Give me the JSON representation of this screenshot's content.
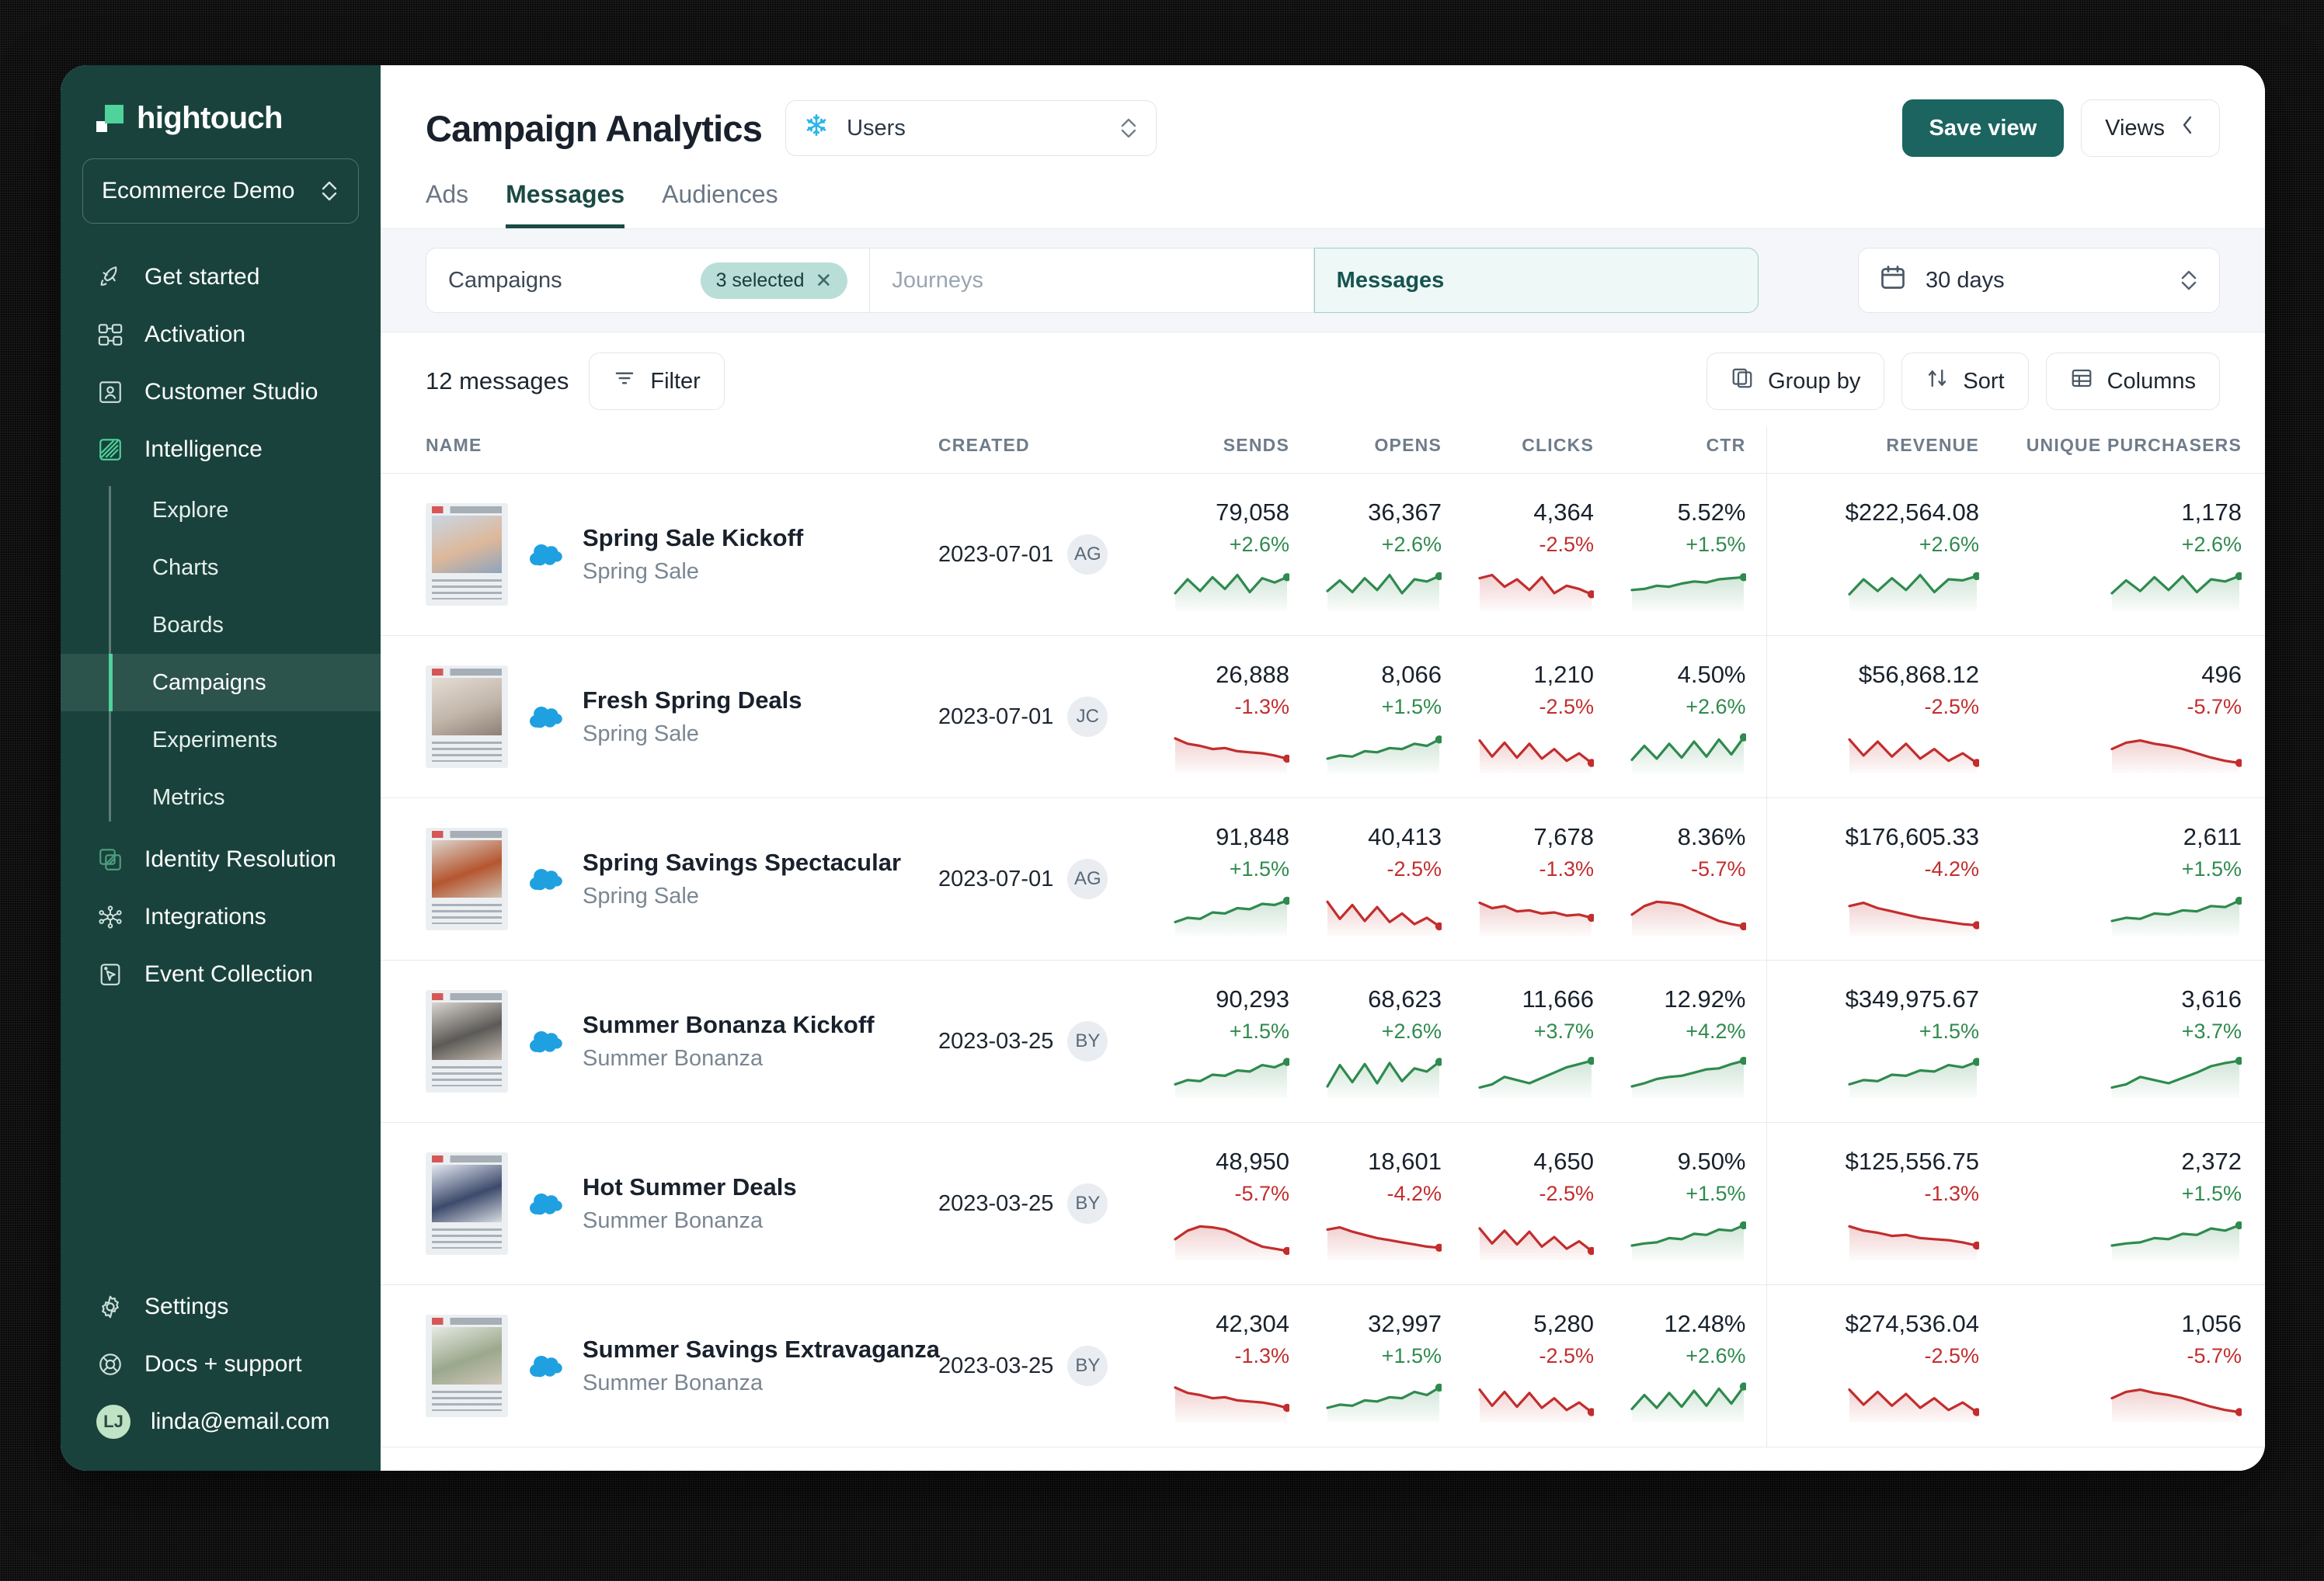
{
  "sidebar": {
    "logo_text": "hightouch",
    "workspace": "Ecommerce Demo",
    "nav": [
      {
        "label": "Get started",
        "icon": "rocket-icon"
      },
      {
        "label": "Activation",
        "icon": "activation-icon"
      },
      {
        "label": "Customer Studio",
        "icon": "customer-studio-icon"
      },
      {
        "label": "Intelligence",
        "icon": "intelligence-icon"
      }
    ],
    "subnav": [
      {
        "label": "Explore",
        "active": false
      },
      {
        "label": "Charts",
        "active": false
      },
      {
        "label": "Boards",
        "active": false
      },
      {
        "label": "Campaigns",
        "active": true
      },
      {
        "label": "Experiments",
        "active": false
      },
      {
        "label": "Metrics",
        "active": false
      }
    ],
    "nav_lower": [
      {
        "label": "Identity Resolution",
        "icon": "identity-resolution-icon"
      },
      {
        "label": "Integrations",
        "icon": "integrations-icon"
      },
      {
        "label": "Event Collection",
        "icon": "event-collection-icon"
      }
    ],
    "bottom": [
      {
        "label": "Settings",
        "icon": "gear-icon"
      },
      {
        "label": "Docs + support",
        "icon": "lifebuoy-icon"
      }
    ],
    "account": {
      "email": "linda@email.com",
      "initials": "LJ"
    }
  },
  "header": {
    "title": "Campaign Analytics",
    "entity_select": {
      "value": "Users",
      "icon": "snowflake-icon"
    },
    "save_view_label": "Save view",
    "views_label": "Views",
    "tabs": [
      {
        "label": "Ads",
        "active": false
      },
      {
        "label": "Messages",
        "active": true
      },
      {
        "label": "Audiences",
        "active": false
      }
    ]
  },
  "filters": {
    "segments": [
      {
        "label": "Campaigns",
        "state": "value",
        "badge": "3 selected"
      },
      {
        "label": "Journeys",
        "state": "placeholder"
      },
      {
        "label": "Messages",
        "state": "selected"
      }
    ],
    "date_range": "30 days"
  },
  "toolbar": {
    "count_label": "12 messages",
    "filter_label": "Filter",
    "group_by_label": "Group by",
    "sort_label": "Sort",
    "columns_label": "Columns"
  },
  "table": {
    "columns": [
      "NAME",
      "CREATED",
      "SENDS",
      "OPENS",
      "CLICKS",
      "CTR",
      "REVENUE",
      "UNIQUE PURCHASERS"
    ],
    "rows": [
      {
        "name": "Spring Sale Kickoff",
        "campaign": "Spring Sale",
        "source": "salesforce",
        "created": "2023-07-01",
        "owner": "AG",
        "thumb_colors": [
          "#c9d6e4",
          "#ddb89a",
          "#8ea4bd"
        ],
        "sends": {
          "value": "79,058",
          "delta": "+2.6%",
          "dir": "up",
          "spark": [
            22,
            48,
            26,
            52,
            30,
            56,
            24,
            50,
            42,
            52
          ]
        },
        "opens": {
          "value": "36,367",
          "delta": "+2.6%",
          "dir": "up",
          "spark": [
            26,
            46,
            24,
            50,
            28,
            56,
            22,
            48,
            44,
            54
          ]
        },
        "clicks": {
          "value": "4,364",
          "delta": "-2.5%",
          "dir": "down",
          "spark": [
            50,
            56,
            34,
            48,
            28,
            52,
            22,
            36,
            30,
            20
          ]
        },
        "ctr": {
          "value": "5.52%",
          "delta": "+1.5%",
          "dir": "up",
          "spark": [
            28,
            30,
            36,
            34,
            40,
            44,
            42,
            48,
            50,
            52
          ]
        },
        "revenue": {
          "value": "$222,564.08",
          "delta": "+2.6%",
          "dir": "up",
          "spark": [
            20,
            48,
            26,
            50,
            28,
            56,
            24,
            48,
            46,
            54
          ]
        },
        "purchasers": {
          "value": "1,178",
          "delta": "+2.6%",
          "dir": "up",
          "spark": [
            22,
            46,
            26,
            52,
            28,
            54,
            24,
            48,
            44,
            54
          ]
        }
      },
      {
        "name": "Fresh Spring Deals",
        "campaign": "Spring Sale",
        "source": "salesforce",
        "created": "2023-07-01",
        "owner": "JC",
        "thumb_colors": [
          "#e4dcd4",
          "#c2b6ab",
          "#8d8076"
        ],
        "sends": {
          "value": "26,888",
          "delta": "-1.3%",
          "dir": "down",
          "spark": [
            54,
            44,
            40,
            34,
            36,
            30,
            28,
            26,
            22,
            16
          ]
        },
        "opens": {
          "value": "8,066",
          "delta": "+1.5%",
          "dir": "up",
          "spark": [
            16,
            22,
            20,
            30,
            28,
            36,
            34,
            44,
            40,
            52
          ]
        },
        "clicks": {
          "value": "1,210",
          "delta": "-2.5%",
          "dir": "down",
          "spark": [
            50,
            20,
            46,
            18,
            44,
            16,
            34,
            12,
            26,
            8
          ]
        },
        "ctr": {
          "value": "4.50%",
          "delta": "+2.6%",
          "dir": "up",
          "spark": [
            14,
            40,
            16,
            44,
            18,
            48,
            20,
            52,
            24,
            56
          ]
        },
        "revenue": {
          "value": "$56,868.12",
          "delta": "-2.5%",
          "dir": "down",
          "spark": [
            52,
            22,
            48,
            20,
            44,
            16,
            34,
            12,
            26,
            8
          ]
        },
        "purchasers": {
          "value": "496",
          "delta": "-5.7%",
          "dir": "down",
          "spark": [
            34,
            46,
            50,
            44,
            40,
            34,
            26,
            18,
            12,
            8
          ]
        }
      },
      {
        "name": "Spring Savings Spectacular",
        "campaign": "Spring Sale",
        "source": "salesforce",
        "created": "2023-07-01",
        "owner": "AG",
        "thumb_colors": [
          "#dcd4cc",
          "#b5562f",
          "#cfc2b4"
        ],
        "sends": {
          "value": "91,848",
          "delta": "+1.5%",
          "dir": "up",
          "spark": [
            14,
            22,
            20,
            32,
            30,
            40,
            38,
            48,
            46,
            54
          ]
        },
        "opens": {
          "value": "40,413",
          "delta": "-2.5%",
          "dir": "down",
          "spark": [
            52,
            20,
            46,
            16,
            42,
            14,
            30,
            10,
            22,
            6
          ]
        },
        "clicks": {
          "value": "7,678",
          "delta": "-1.3%",
          "dir": "down",
          "spark": [
            50,
            40,
            44,
            34,
            36,
            30,
            32,
            26,
            28,
            22
          ]
        },
        "ctr": {
          "value": "8.36%",
          "delta": "-5.7%",
          "dir": "down",
          "spark": [
            28,
            44,
            52,
            50,
            46,
            36,
            26,
            16,
            10,
            6
          ]
        },
        "revenue": {
          "value": "$176,605.33",
          "delta": "-4.2%",
          "dir": "down",
          "spark": [
            44,
            50,
            40,
            34,
            28,
            22,
            18,
            14,
            10,
            8
          ]
        },
        "purchasers": {
          "value": "2,611",
          "delta": "+1.5%",
          "dir": "up",
          "spark": [
            16,
            22,
            20,
            30,
            28,
            36,
            34,
            44,
            42,
            54
          ]
        }
      },
      {
        "name": "Summer Bonanza Kickoff",
        "campaign": "Summer Bonanza",
        "source": "salesforce",
        "created": "2023-03-25",
        "owner": "BY",
        "thumb_colors": [
          "#d8d4cf",
          "#5c5a57",
          "#c6bdb2"
        ],
        "sends": {
          "value": "90,293",
          "delta": "+1.5%",
          "dir": "up",
          "spark": [
            14,
            22,
            20,
            32,
            30,
            40,
            38,
            50,
            46,
            56
          ]
        },
        "opens": {
          "value": "68,623",
          "delta": "+2.6%",
          "dir": "up",
          "spark": [
            10,
            50,
            18,
            52,
            16,
            54,
            20,
            44,
            38,
            56
          ]
        },
        "clicks": {
          "value": "11,666",
          "delta": "+3.7%",
          "dir": "up",
          "spark": [
            8,
            14,
            28,
            22,
            16,
            26,
            36,
            46,
            52,
            58
          ]
        },
        "ctr": {
          "value": "12.92%",
          "delta": "+4.2%",
          "dir": "up",
          "spark": [
            10,
            16,
            24,
            28,
            30,
            36,
            42,
            44,
            52,
            58
          ]
        },
        "revenue": {
          "value": "$349,975.67",
          "delta": "+1.5%",
          "dir": "up",
          "spark": [
            14,
            22,
            20,
            32,
            30,
            40,
            38,
            50,
            46,
            56
          ]
        },
        "purchasers": {
          "value": "3,616",
          "delta": "+3.7%",
          "dir": "up",
          "spark": [
            8,
            14,
            28,
            22,
            16,
            26,
            36,
            48,
            54,
            58
          ]
        }
      },
      {
        "name": "Hot Summer Deals",
        "campaign": "Summer Bonanza",
        "source": "salesforce",
        "created": "2023-03-25",
        "owner": "BY",
        "thumb_colors": [
          "#e3e8f2",
          "#3d4a6b",
          "#d7dbe2"
        ],
        "sends": {
          "value": "48,950",
          "delta": "-5.7%",
          "dir": "down",
          "spark": [
            28,
            44,
            52,
            50,
            46,
            36,
            24,
            14,
            10,
            6
          ]
        },
        "opens": {
          "value": "18,601",
          "delta": "-4.2%",
          "dir": "down",
          "spark": [
            46,
            50,
            42,
            36,
            30,
            26,
            22,
            18,
            14,
            12
          ]
        },
        "clicks": {
          "value": "4,650",
          "delta": "-2.5%",
          "dir": "down",
          "spark": [
            48,
            20,
            44,
            18,
            42,
            14,
            32,
            10,
            24,
            6
          ]
        },
        "ctr": {
          "value": "9.50%",
          "delta": "+1.5%",
          "dir": "up",
          "spark": [
            16,
            20,
            22,
            30,
            28,
            38,
            36,
            46,
            44,
            54
          ]
        },
        "revenue": {
          "value": "$125,556.75",
          "delta": "-1.3%",
          "dir": "down",
          "spark": [
            52,
            44,
            40,
            34,
            36,
            30,
            28,
            26,
            22,
            16
          ]
        },
        "purchasers": {
          "value": "2,372",
          "delta": "+1.5%",
          "dir": "up",
          "spark": [
            16,
            20,
            22,
            30,
            28,
            38,
            36,
            48,
            44,
            54
          ]
        }
      },
      {
        "name": "Summer Savings Extravaganza",
        "campaign": "Summer Bonanza",
        "source": "salesforce",
        "created": "2023-03-25",
        "owner": "BY",
        "thumb_colors": [
          "#e6e9e2",
          "#9aa88c",
          "#cfc6b8"
        ],
        "sends": {
          "value": "42,304",
          "delta": "-1.3%",
          "dir": "down",
          "spark": [
            54,
            44,
            40,
            34,
            36,
            30,
            28,
            26,
            22,
            16
          ]
        },
        "opens": {
          "value": "32,997",
          "delta": "+1.5%",
          "dir": "up",
          "spark": [
            16,
            22,
            20,
            30,
            28,
            36,
            34,
            46,
            40,
            54
          ]
        },
        "clicks": {
          "value": "5,280",
          "delta": "-2.5%",
          "dir": "down",
          "spark": [
            50,
            20,
            46,
            18,
            44,
            16,
            34,
            12,
            26,
            8
          ]
        },
        "ctr": {
          "value": "12.48%",
          "delta": "+2.6%",
          "dir": "up",
          "spark": [
            14,
            40,
            16,
            44,
            18,
            48,
            20,
            52,
            24,
            56
          ]
        },
        "revenue": {
          "value": "$274,536.04",
          "delta": "-2.5%",
          "dir": "down",
          "spark": [
            50,
            22,
            46,
            20,
            42,
            16,
            34,
            12,
            26,
            8
          ]
        },
        "purchasers": {
          "value": "1,056",
          "delta": "-5.7%",
          "dir": "down",
          "spark": [
            34,
            46,
            50,
            44,
            40,
            34,
            26,
            18,
            12,
            8
          ]
        }
      }
    ]
  },
  "colors": {
    "brand_dark": "#19423c",
    "brand_green": "#4fd39a",
    "accent": "#1b6460",
    "up": "#2f8a4e",
    "down": "#c22d2d"
  }
}
